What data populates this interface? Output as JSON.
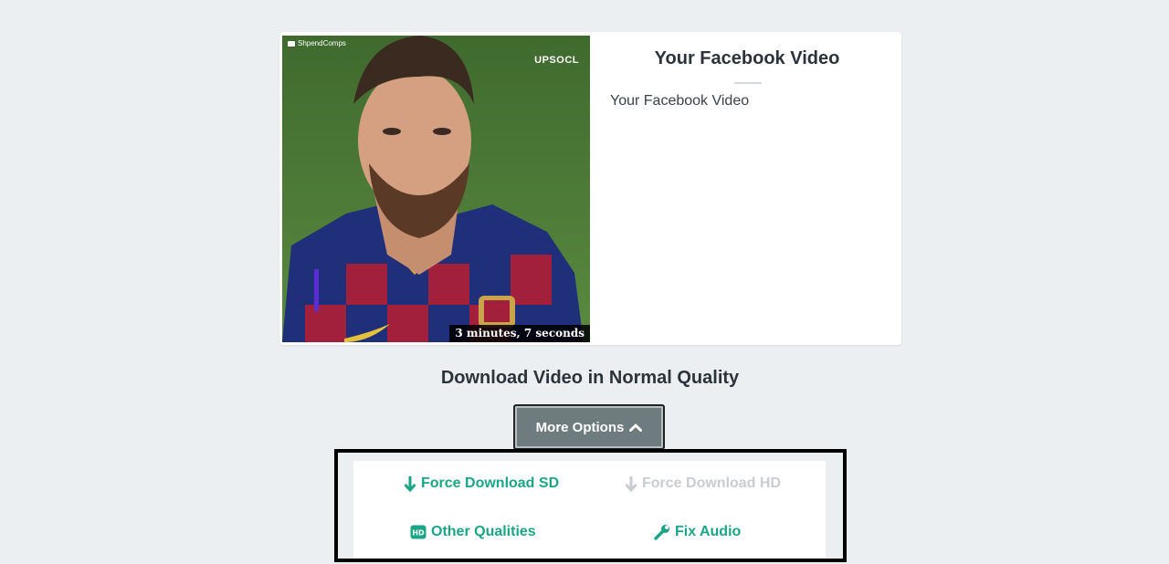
{
  "video": {
    "channel_tag": "ShpendComps",
    "watermark": "UPSOCL",
    "duration": "3 minutes, 7 seconds"
  },
  "info": {
    "title": "Your Facebook Video",
    "description": "Your Facebook Video"
  },
  "quality_heading": "Download Video in Normal Quality",
  "more_options": {
    "label": "More Options",
    "icon": "chevron-up-icon"
  },
  "options": {
    "force_sd": {
      "label": "Force Download SD",
      "icon": "arrow-down-icon",
      "enabled": true
    },
    "force_hd": {
      "label": "Force Download HD",
      "icon": "arrow-down-icon",
      "enabled": false
    },
    "other_qualities": {
      "label": "Other Qualities",
      "icon": "hd-icon",
      "enabled": true
    },
    "fix_audio": {
      "label": "Fix Audio",
      "icon": "wrench-icon",
      "enabled": true
    }
  },
  "colors": {
    "accent": "#1aa686",
    "disabled": "#c9cdd0",
    "button_bg": "#6f7c7f",
    "page_bg": "#eceff1"
  }
}
